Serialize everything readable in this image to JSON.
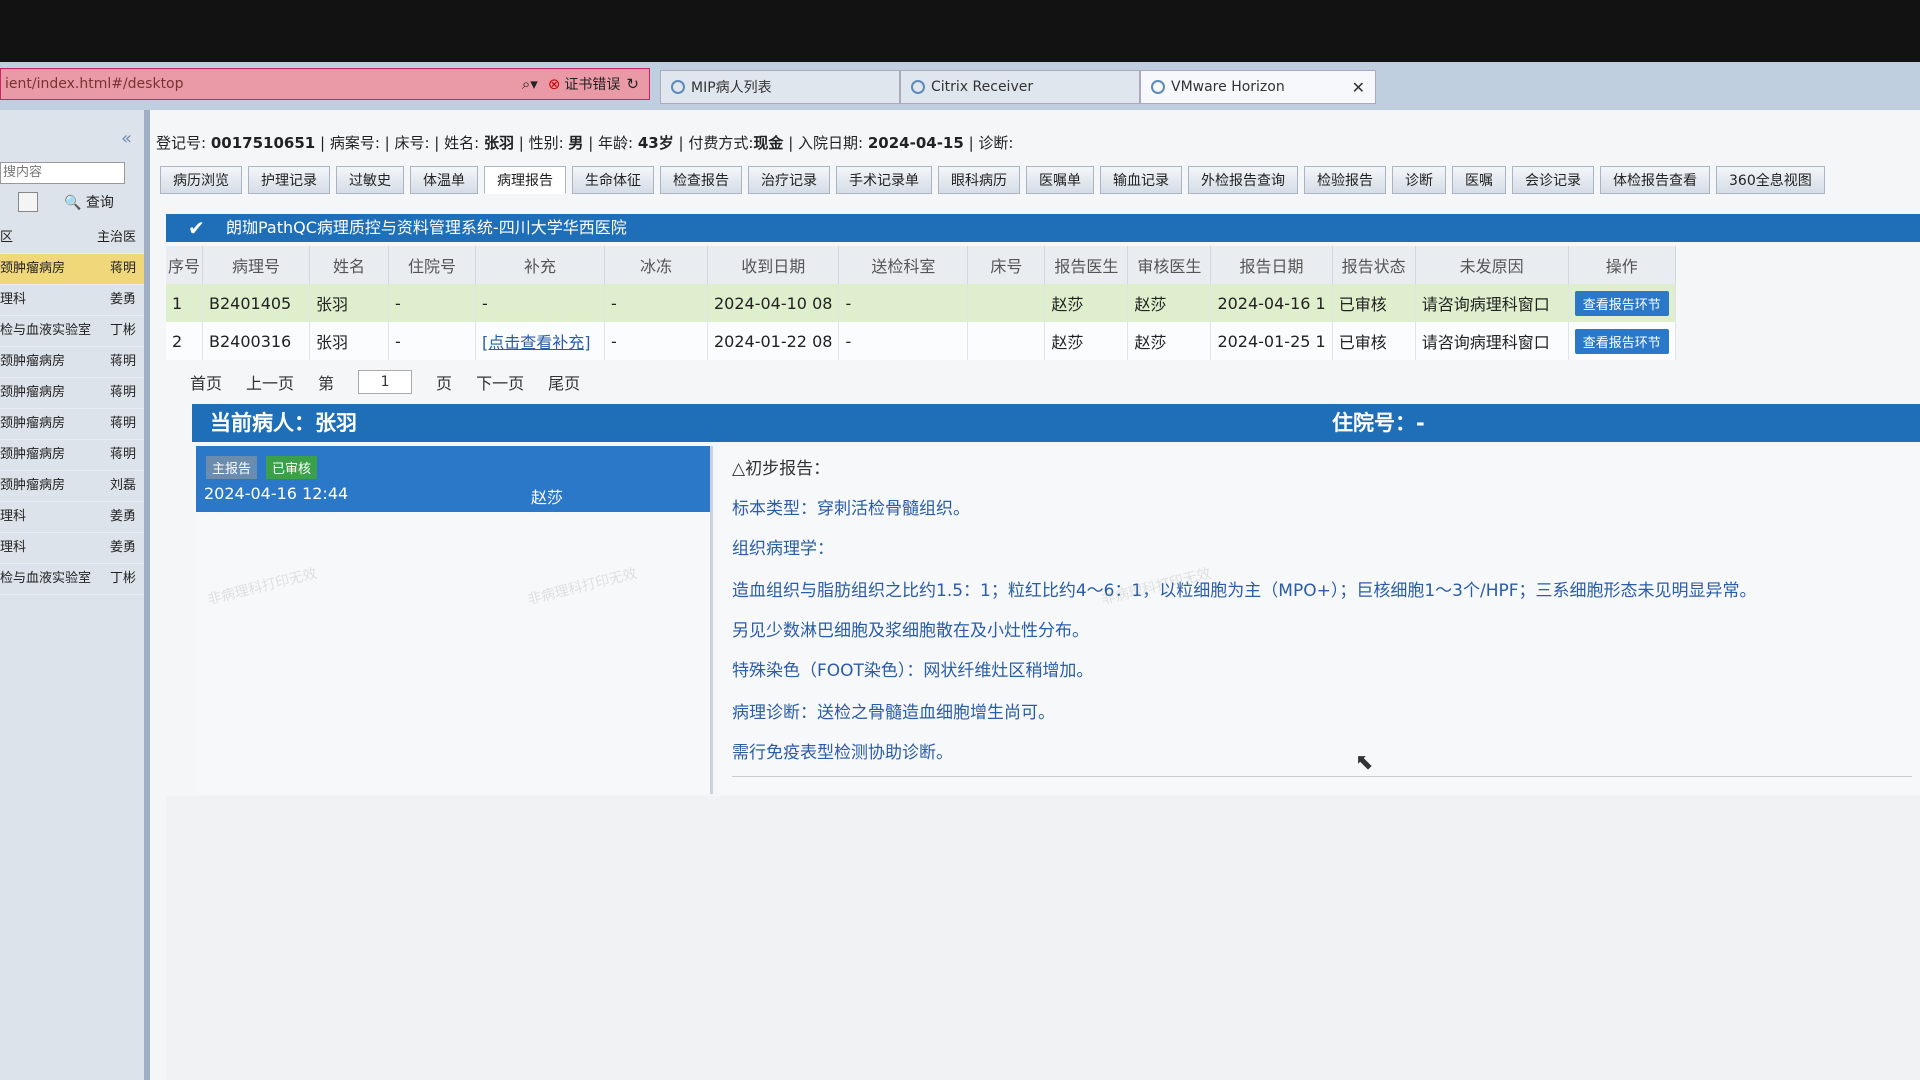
{
  "browser": {
    "url": "ient/index.html#/desktop",
    "cert_error": "证书错误",
    "tabs": [
      {
        "label": "MIP病人列表"
      },
      {
        "label": "Citrix Receiver"
      },
      {
        "label": "VMware Horizon"
      }
    ]
  },
  "sidebar": {
    "search_placeholder": "搜内容",
    "query_label": "查询",
    "header_col2": "主治医",
    "header_col1": "区",
    "items": [
      {
        "dept": "颈肿瘤病房",
        "doctor": "蒋明"
      },
      {
        "dept": "理科",
        "doctor": "姜勇"
      },
      {
        "dept": "检与血液实验室",
        "doctor": "丁彬"
      },
      {
        "dept": "颈肿瘤病房",
        "doctor": "蒋明"
      },
      {
        "dept": "颈肿瘤病房",
        "doctor": "蒋明"
      },
      {
        "dept": "颈肿瘤病房",
        "doctor": "蒋明"
      },
      {
        "dept": "颈肿瘤病房",
        "doctor": "蒋明"
      },
      {
        "dept": "颈肿瘤病房",
        "doctor": "刘磊"
      },
      {
        "dept": "理科",
        "doctor": "姜勇"
      },
      {
        "dept": "理科",
        "doctor": "姜勇"
      },
      {
        "dept": "检与血液实验室",
        "doctor": "丁彬"
      }
    ]
  },
  "patient_info": {
    "reg_label": "登记号:",
    "reg_no": "0017510651",
    "case_label": "病案号:",
    "bed_label": "床号:",
    "name_label": "姓名:",
    "name": "张羽",
    "sex_label": "性别:",
    "sex": "男",
    "age_label": "年龄:",
    "age": "43岁",
    "pay_label": "付费方式:",
    "pay": "现金",
    "admit_label": "入院日期:",
    "admit_date": "2024-04-15",
    "diag_label": "诊断:"
  },
  "top_tabs": [
    "病历浏览",
    "护理记录",
    "过敏史",
    "体温单",
    "病理报告",
    "生命体征",
    "检查报告",
    "治疗记录",
    "手术记录单",
    "眼科病历",
    "医嘱单",
    "输血记录",
    "外检报告查询",
    "检验报告",
    "诊断",
    "医嘱",
    "会诊记录",
    "体检报告查看",
    "360全息视图"
  ],
  "system_title": "朗珈PathQC病理质控与资料管理系统-四川大学华西医院",
  "table": {
    "headers": [
      "序号",
      "病理号",
      "姓名",
      "住院号",
      "补充",
      "冰冻",
      "收到日期",
      "送检科室",
      "床号",
      "报告医生",
      "审核医生",
      "报告日期",
      "报告状态",
      "未发原因",
      "操作"
    ],
    "rows": [
      {
        "idx": "1",
        "path_no": "B2401405",
        "name": "张羽",
        "inpatient": "-",
        "supp": "-",
        "frozen": "-",
        "recv": "2024-04-10 08",
        "dept": "-",
        "bed": "",
        "rpt_doc": "赵莎",
        "audit_doc": "赵莎",
        "rpt_date": "2024-04-16 1",
        "status": "已审核",
        "reason": "请咨询病理科窗口",
        "action": "查看报告环节"
      },
      {
        "idx": "2",
        "path_no": "B2400316",
        "name": "张羽",
        "inpatient": "-",
        "supp": "[点击查看补充]",
        "frozen": "-",
        "recv": "2024-01-22 08",
        "dept": "-",
        "bed": "",
        "rpt_doc": "赵莎",
        "audit_doc": "赵莎",
        "rpt_date": "2024-01-25 1",
        "status": "已审核",
        "reason": "请咨询病理科窗口",
        "action": "查看报告环节"
      }
    ]
  },
  "pager": {
    "first": "首页",
    "prev": "上一页",
    "page_prefix": "第",
    "page": "1",
    "page_suffix": "页",
    "next": "下一页",
    "last": "尾页"
  },
  "current_patient": {
    "label": "当前病人：张羽",
    "inpatient_label": "住院号：-"
  },
  "report_card": {
    "badge_main": "主报告",
    "badge_status": "已审核",
    "datetime": "2024-04-16 12:44",
    "doctor": "赵莎"
  },
  "report": {
    "l1": "△初步报告：",
    "l2": "标本类型：穿刺活检骨髓组织。",
    "l3": "组织病理学：",
    "l4": "造血组织与脂肪组织之比约1.5：1；粒红比约4～6：1，以粒细胞为主（MPO+）；巨核细胞1～3个/HPF；三系细胞形态未见明显异常。",
    "l5": "另见少数淋巴细胞及浆细胞散在及小灶性分布。",
    "l6": "特殊染色（FOOT染色）：网状纤维灶区稍增加。",
    "l7": "病理诊断：送检之骨髓造血细胞增生尚可。",
    "l8": "需行免疫表型检测协助诊断。"
  },
  "watermark": "非病理科打印无效"
}
